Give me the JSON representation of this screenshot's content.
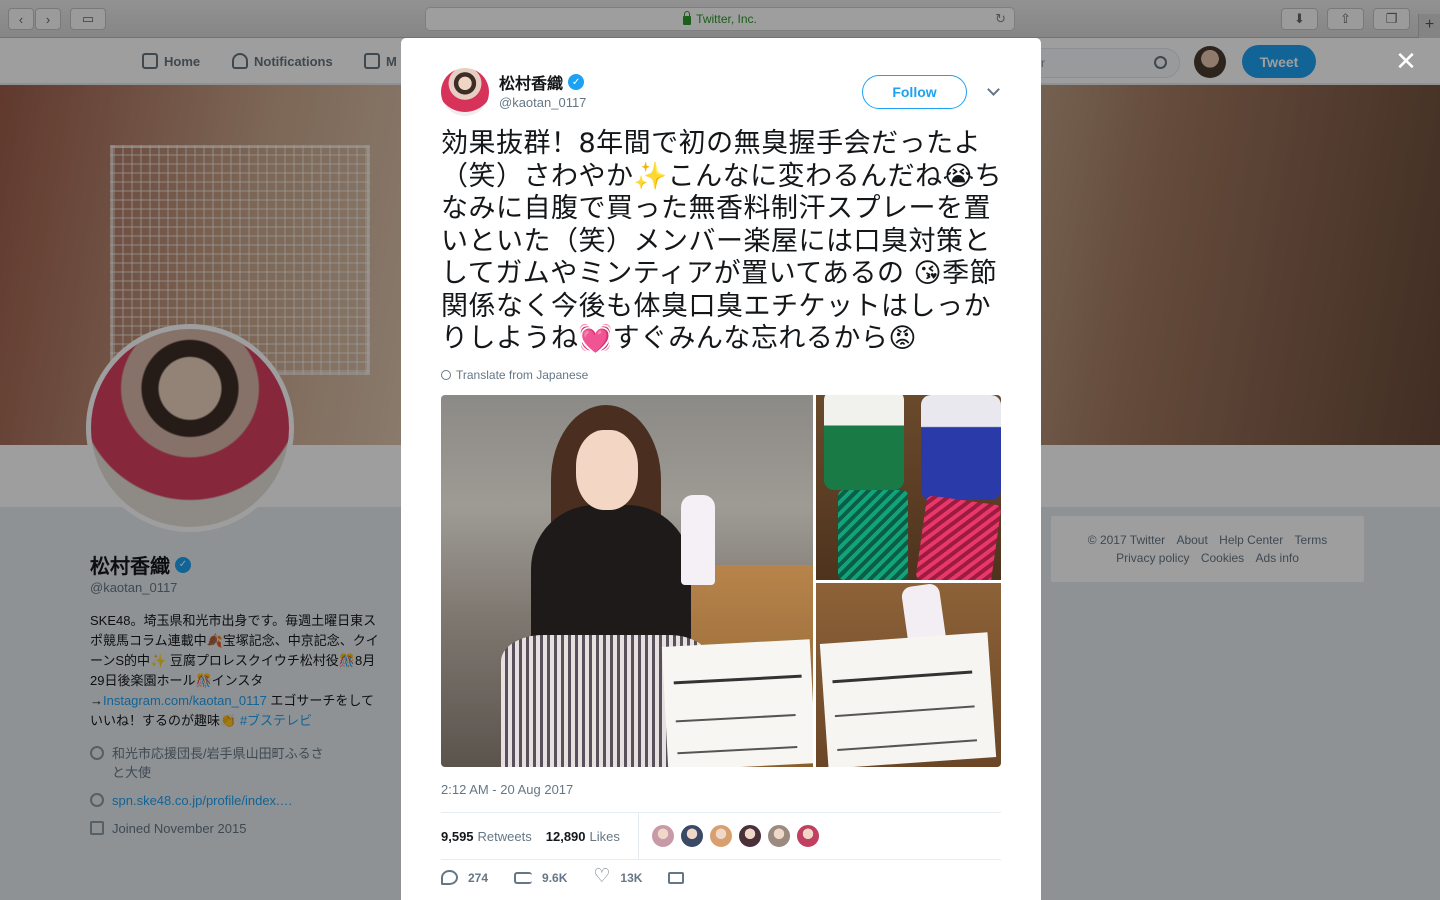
{
  "browser": {
    "url_text": "Twitter, Inc.",
    "newtab_label": "+"
  },
  "topnav": {
    "home": "Home",
    "notifications": "Notifications",
    "messages_partial": "M",
    "search_partial": "r",
    "tweet_button": "Tweet"
  },
  "profile": {
    "name": "松村香織",
    "verified_mark": "✓",
    "handle": "@kaotan_0117",
    "bio_text_1": "SKE48。埼玉県和光市出身です。毎週土曜日東スポ競馬コラム連載中🍂宝塚記念、中京記念、クイーンS的中✨ 豆腐プロレスクイウチ松村役🎊8月29日後楽園ホール🎊インスタ→",
    "bio_link": "Instagram.com/kaotan_0117",
    "bio_text_2": " エゴサーチをしていいね！するのが趣味👏 ",
    "bio_hashtag": "#ブステレビ",
    "location": "和光市応援団長/岩手県山田町ふるさと大使",
    "website": "spn.ske48.co.jp/profile/index.…",
    "joined": "Joined November 2015"
  },
  "footer": {
    "links_row1": [
      "© 2017 Twitter",
      "About",
      "Help Center",
      "Terms"
    ],
    "links_row2": [
      "Privacy policy",
      "Cookies",
      "Ads info"
    ]
  },
  "modal": {
    "close_label": "✕",
    "author_name": "松村香織",
    "verified_mark": "✓",
    "author_handle": "@kaotan_0117",
    "follow_label": "Follow",
    "tweet_text": "効果抜群！8年間で初の無臭握手会だったよ（笑）さわやか✨こんなに変わるんだね😭ちなみに自腹で買った無香料制汗スプレーを置いといた（笑）メンバー楽屋には口臭対策としてガムやミンティアが置いてあるの 😘季節関係なく今後も体臭口臭エチケットはしっかりしようね💓すぐみんな忘れるから😡",
    "translate_label": "Translate from Japanese",
    "timestamp": "2:12 AM - 20 Aug 2017",
    "retweets_count": "9,595",
    "retweets_label": "Retweets",
    "likes_count": "12,890",
    "likes_label": "Likes",
    "likers": [
      "#c89aa8",
      "#3a4a66",
      "#d8a070",
      "#4a3038",
      "#9a8a80",
      "#c04060"
    ],
    "actions": {
      "reply_count": "274",
      "retweet_count": "9.6K",
      "like_count": "13K"
    }
  }
}
